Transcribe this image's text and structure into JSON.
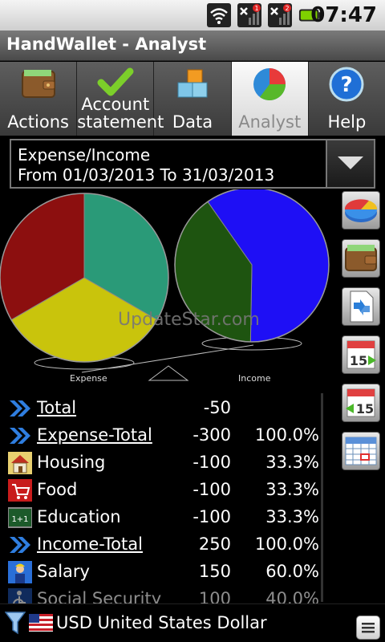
{
  "status_bar": {
    "time": "07:47",
    "notif_1": "1",
    "notif_2": "2"
  },
  "app": {
    "title": "HandWallet - Analyst"
  },
  "tabs": [
    {
      "label": "Actions",
      "icon": "wallet-icon"
    },
    {
      "label_line1": "Account",
      "label_line2": "statement",
      "icon": "checkmark-icon"
    },
    {
      "label": "Data",
      "icon": "blocks-icon"
    },
    {
      "label": "Analyst",
      "icon": "pie-chart-icon",
      "active": true
    },
    {
      "label": "Help",
      "icon": "help-icon"
    }
  ],
  "selector": {
    "line1": "Expense/Income",
    "line2": "From 01/03/2013 To 31/03/2013"
  },
  "chart_data": [
    {
      "type": "pie",
      "title": "Expense",
      "categories": [
        "Housing",
        "Food",
        "Education"
      ],
      "values": [
        33.3,
        33.3,
        33.3
      ],
      "colors": [
        "#2a9a78",
        "#c9c40c",
        "#8c0f0f"
      ]
    },
    {
      "type": "pie",
      "title": "Income",
      "categories": [
        "Salary",
        "Social Security"
      ],
      "values": [
        60.0,
        40.0
      ],
      "colors": [
        "#1e0ff5",
        "#1e5410"
      ]
    }
  ],
  "watermark": "UpdateStar.com",
  "rows": [
    {
      "name": "Total",
      "amount": "-50",
      "pct": "",
      "icon": "double-chevron-icon",
      "link": true
    },
    {
      "name": "Expense-Total",
      "amount": "-300",
      "pct": "100.0%",
      "icon": "double-chevron-icon",
      "link": true
    },
    {
      "name": "Housing",
      "amount": "-100",
      "pct": "33.3%",
      "icon": "house-icon",
      "link": false
    },
    {
      "name": "Food",
      "amount": "-100",
      "pct": "33.3%",
      "icon": "shopping-cart-icon",
      "link": false
    },
    {
      "name": "Education",
      "amount": "-100",
      "pct": "33.3%",
      "icon": "chalkboard-icon",
      "link": false
    },
    {
      "name": "Income-Total",
      "amount": "250",
      "pct": "100.0%",
      "icon": "double-chevron-icon",
      "link": true
    },
    {
      "name": "Salary",
      "amount": "150",
      "pct": "60.0%",
      "icon": "worker-icon",
      "link": false
    },
    {
      "name": "Social Security",
      "amount": "100",
      "pct": "40.0%",
      "icon": "wheelchair-icon",
      "link": false
    }
  ],
  "bottom": {
    "currency": "USD United States Dollar"
  },
  "colors": {
    "accent_blue": "#1f6fd6",
    "tab_bar": "#4a4a4a"
  }
}
